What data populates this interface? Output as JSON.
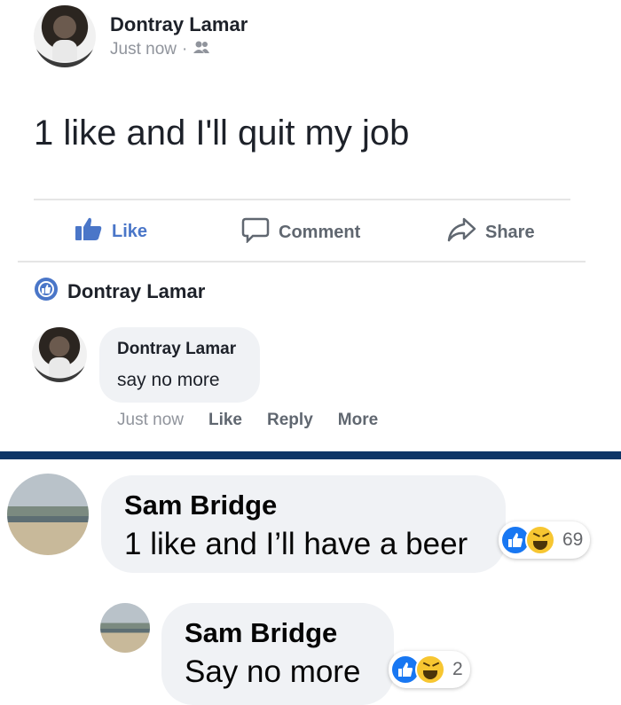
{
  "post": {
    "author": "Dontray Lamar",
    "time": "Just now",
    "privacy_icon": "friends-icon",
    "text": "1 like and I'll quit my job",
    "actions": {
      "like": "Like",
      "comment": "Comment",
      "share": "Share"
    }
  },
  "reply_header": {
    "name": "Dontray Lamar"
  },
  "comment": {
    "author": "Dontray Lamar",
    "text": "say no more",
    "time": "Just now",
    "like": "Like",
    "reply": "Reply",
    "more": "More"
  },
  "bottom": {
    "comment1": {
      "author": "Sam Bridge",
      "text": "1 like and I’ll have a beer",
      "reactions": [
        "like",
        "haha"
      ],
      "count": "69"
    },
    "comment2": {
      "author": "Sam Bridge",
      "text": "Say no more",
      "reactions": [
        "like",
        "haha"
      ],
      "count": "2"
    }
  },
  "colors": {
    "accent": "#4a76c8",
    "separator": "#0d3566",
    "like_reaction": "#1877f2",
    "haha_reaction": "#f7c631"
  }
}
